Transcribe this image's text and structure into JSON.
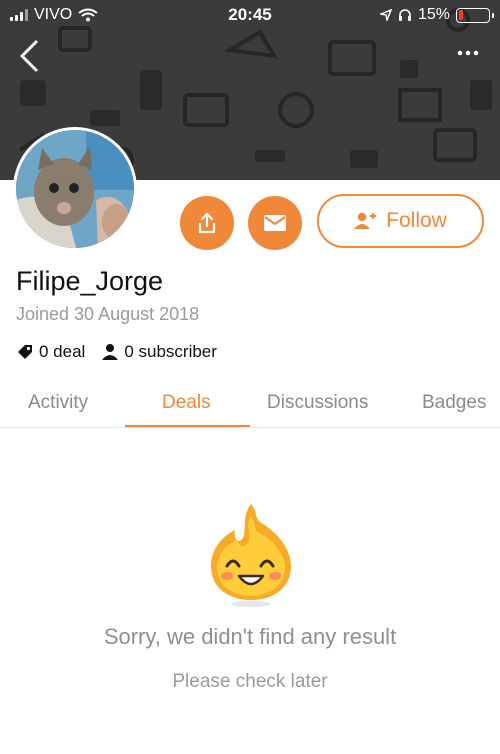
{
  "status_bar": {
    "carrier": "VIVO",
    "time": "20:45",
    "battery_percent": "15%",
    "battery_level": 0.15,
    "battery_color": "#ff3b30"
  },
  "header": {
    "back_icon": "chevron-left-icon",
    "more_icon": "more-dots-icon",
    "banner_color": "#3b3b3b"
  },
  "profile": {
    "username": "Filipe_Jorge",
    "joined": "Joined 30 August 2018",
    "deal_count": "0 deal",
    "subscriber_count": "0 subscriber",
    "share_icon": "share-icon",
    "message_icon": "envelope-icon",
    "follow_label": "Follow",
    "follow_icon": "add-person-icon",
    "accent_color": "#f0883a"
  },
  "tabs": [
    {
      "label": "Activity",
      "active": false
    },
    {
      "label": "Deals",
      "active": true
    },
    {
      "label": "Discussions",
      "active": false
    },
    {
      "label": "Badges",
      "active": false
    }
  ],
  "empty_state": {
    "icon": "flame-mascot-icon",
    "title": "Sorry, we didn't find any result",
    "subtitle": "Please check later"
  }
}
